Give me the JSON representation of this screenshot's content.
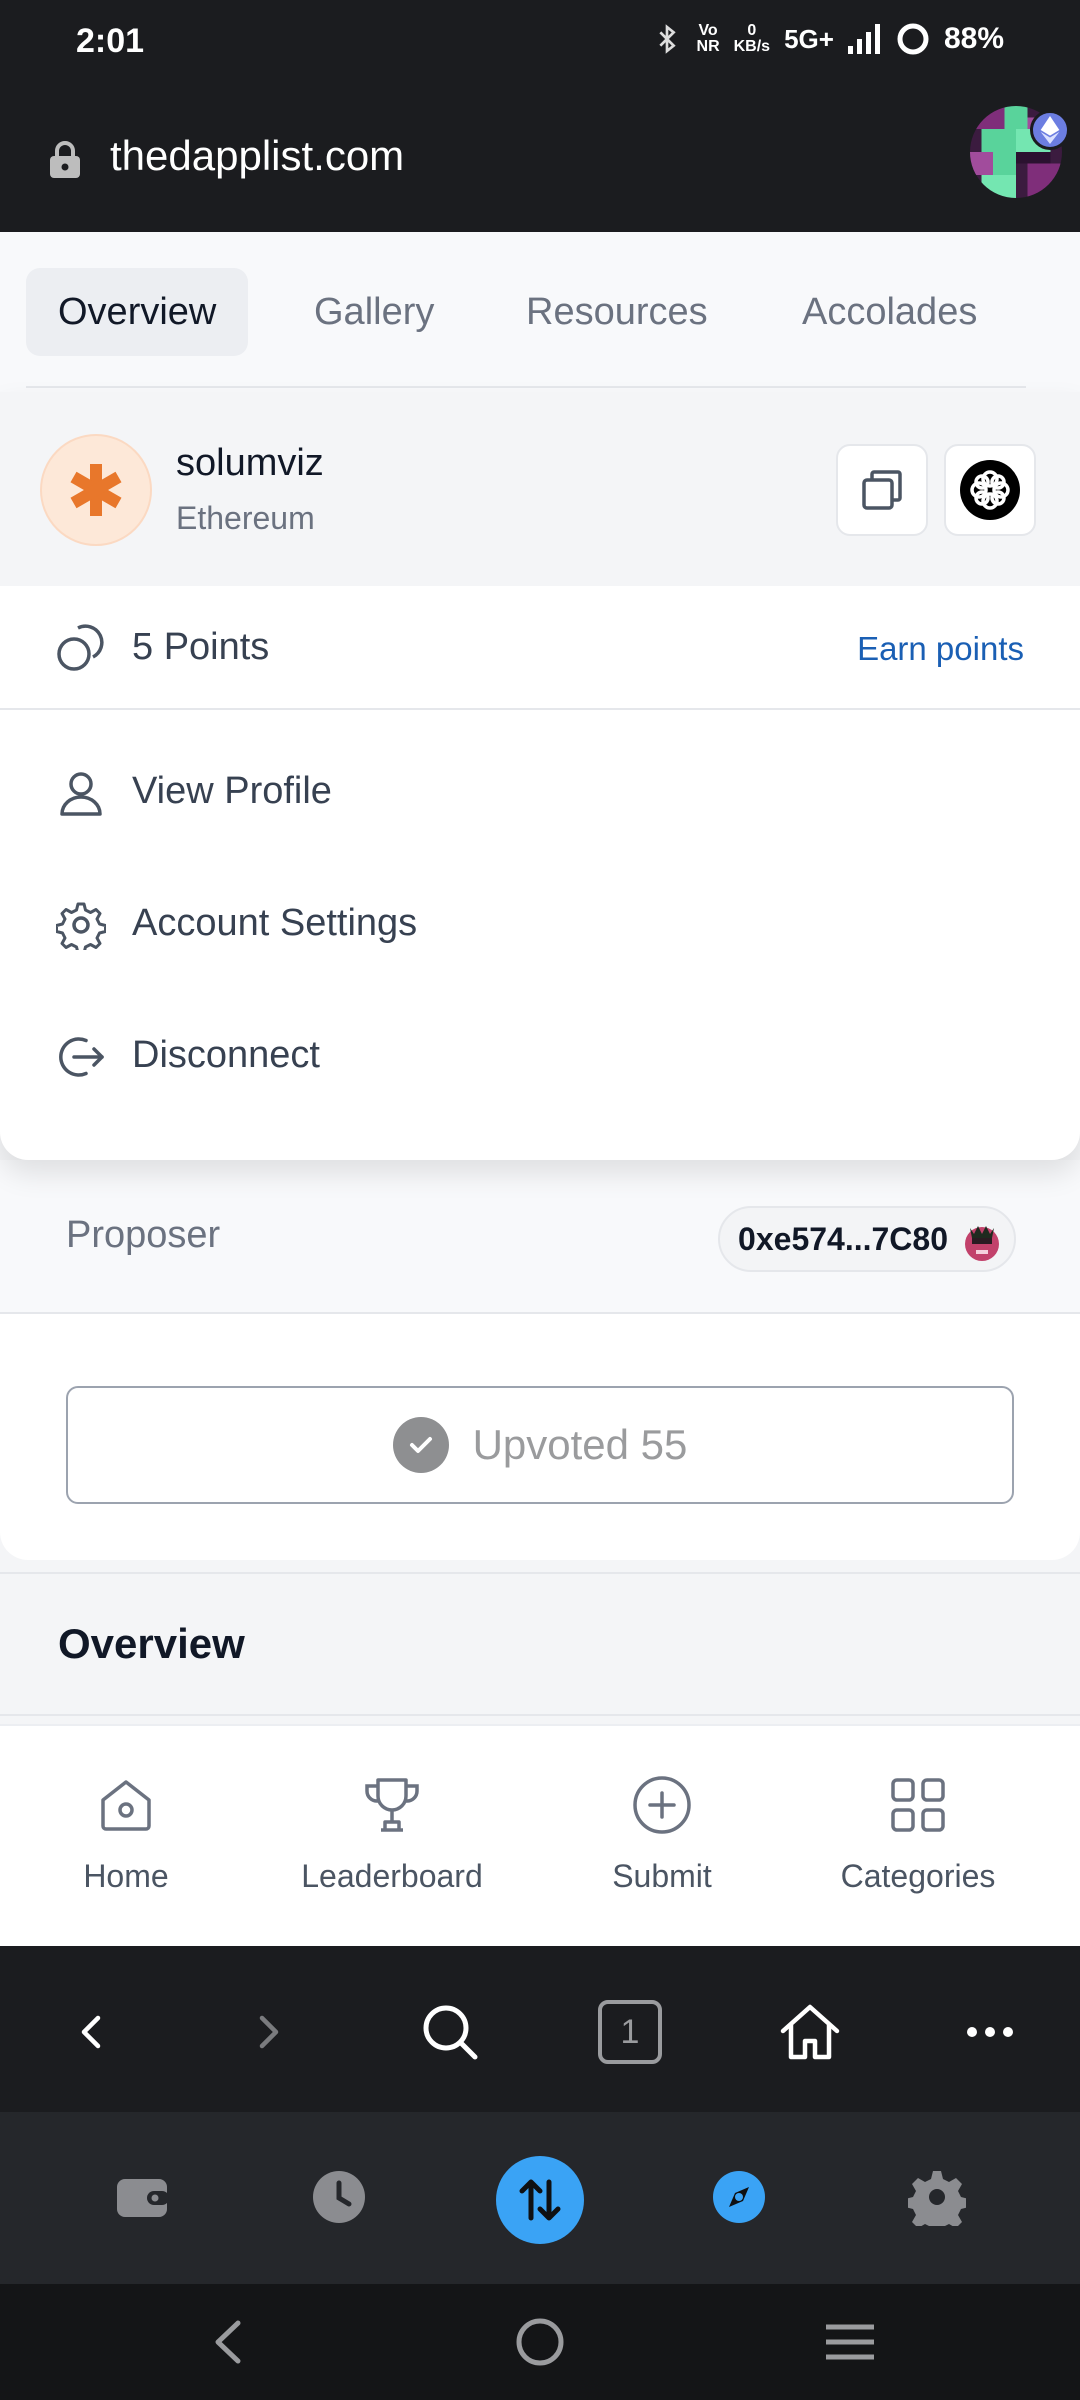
{
  "status_bar": {
    "time": "2:01",
    "network_top": "Vo",
    "network_bottom": "NR",
    "speed_value": "0",
    "speed_unit": "KB/s",
    "cell_type": "5G+",
    "battery": "88%"
  },
  "address_bar": {
    "url": "thedapplist.com"
  },
  "tabs": [
    {
      "label": "Overview",
      "active": true
    },
    {
      "label": "Gallery",
      "active": false
    },
    {
      "label": "Resources",
      "active": false
    },
    {
      "label": "Accolades",
      "active": false
    }
  ],
  "account": {
    "name": "solumviz",
    "chain": "Ethereum",
    "points": "5 Points",
    "earn_points": "Earn points"
  },
  "menu": {
    "view_profile": "View Profile",
    "account_settings": "Account Settings",
    "disconnect": "Disconnect"
  },
  "proposer": {
    "label": "Proposer",
    "address": "0xe574...7C80"
  },
  "upvote": {
    "label": "Upvoted 55"
  },
  "overview": {
    "title": "Overview"
  },
  "bottom_nav": [
    {
      "label": "Home",
      "icon": "home-icon"
    },
    {
      "label": "Leaderboard",
      "icon": "trophy-icon"
    },
    {
      "label": "Submit",
      "icon": "plus-circle-icon"
    },
    {
      "label": "Categories",
      "icon": "grid-icon"
    }
  ],
  "browser_toolbar": {
    "tab_count": "1"
  },
  "colors": {
    "accent_link": "#1a5fb4",
    "swap_blue": "#3aa3f5",
    "account_avatar": "#e8772b"
  }
}
